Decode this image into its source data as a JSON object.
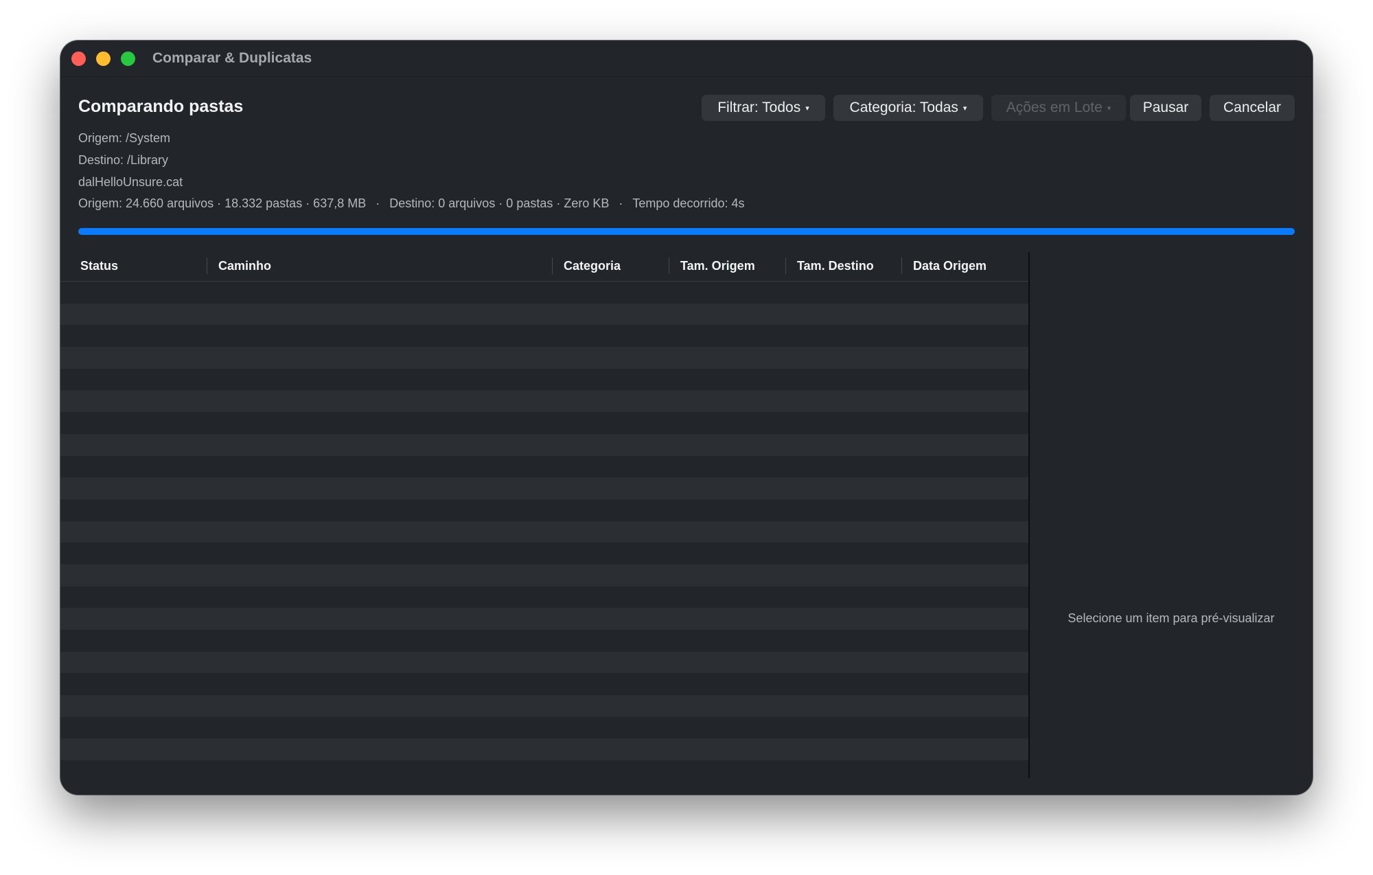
{
  "window": {
    "title": "Comparar & Duplicatas"
  },
  "header": {
    "title": "Comparando pastas",
    "origin": "Origem: /System",
    "destination": "Destino: /Library",
    "current_file": "dalHelloUnsure.cat",
    "stats": {
      "origin": "Origem: 24.660 arquivos · 18.332 pastas · 637,8 MB",
      "separator": "·",
      "destination": "Destino: 0 arquivos · 0 pastas · Zero KB",
      "elapsed": "Tempo decorrido: 4s"
    }
  },
  "toolbar": {
    "filter_label": "Filtrar: Todos",
    "category_label": "Categoria: Todas",
    "batch_label": "Ações em Lote",
    "pause_label": "Pausar",
    "cancel_label": "Cancelar",
    "dropdown_caret": "▾"
  },
  "progress": {
    "fraction": 1.0,
    "color": "#0a7aff"
  },
  "table": {
    "columns": [
      "Status",
      "Caminho",
      "Categoria",
      "Tam. Origem",
      "Tam. Destino",
      "Data Origem"
    ],
    "rows": []
  },
  "preview": {
    "placeholder": "Selecione um item para pré-visualizar"
  },
  "colors": {
    "close": "#fe5f57",
    "minimize": "#febc2e",
    "maximize": "#28c840",
    "accent": "#0a7aff"
  }
}
